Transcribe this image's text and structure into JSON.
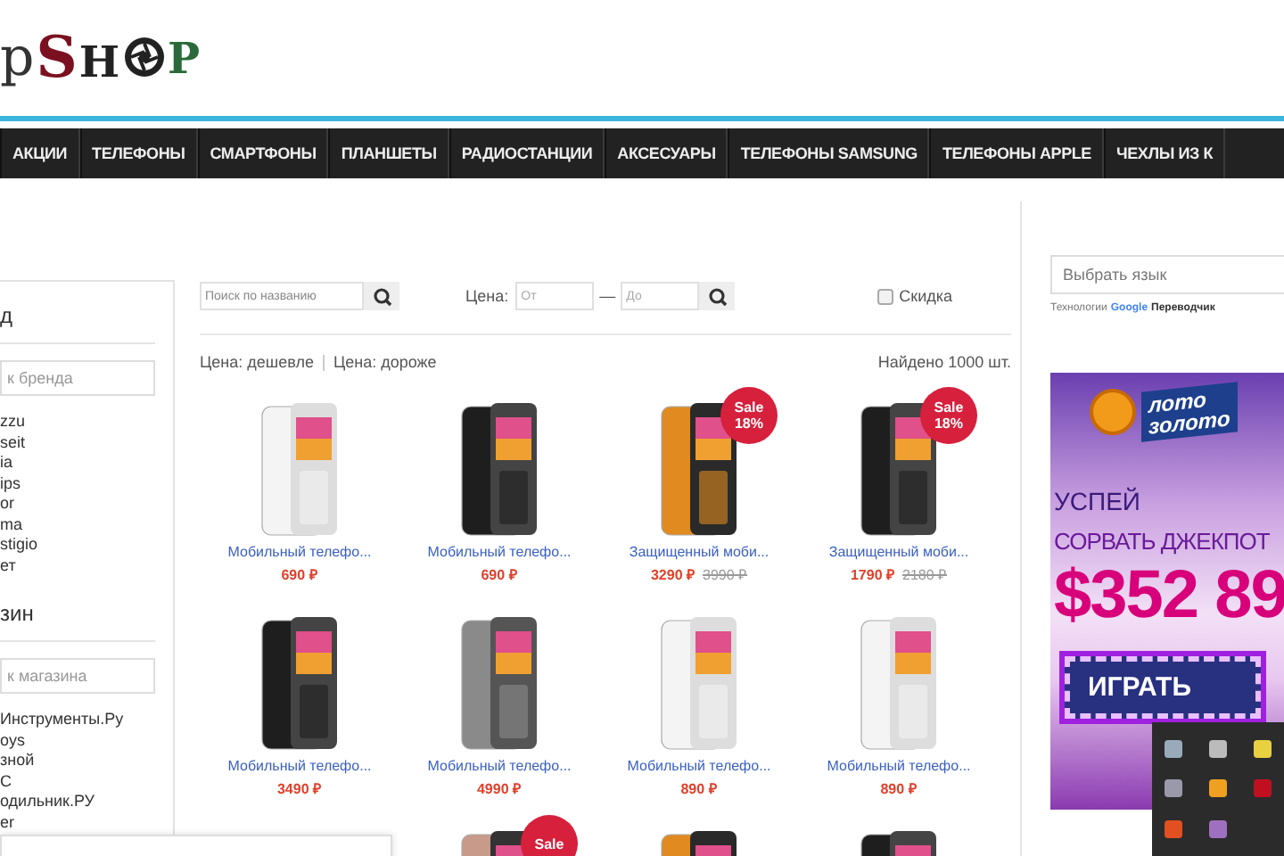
{
  "logo": {
    "prefix": "p",
    "left": "SH",
    "right": "P"
  },
  "nav": [
    "АКЦИИ",
    "ТЕЛЕФОНЫ",
    "СМАРТФОНЫ",
    "ПЛАНШЕТЫ",
    "РАДИОСТАНЦИИ",
    "АКСЕСУАРЫ",
    "ТЕЛЕФОНЫ SAMSUNG",
    "ТЕЛЕФОНЫ APPLE",
    "ЧЕХЛЫ ИЗ К"
  ],
  "sidebar": {
    "brand_heading": "д",
    "brand_search": {
      "placeholder": "к бренда"
    },
    "brands": [
      "zzu",
      "seit",
      "ia",
      "ips",
      "or",
      "ma",
      "stigio",
      "ет"
    ],
    "store_heading": "зин",
    "store_search": {
      "placeholder": "к магазина"
    },
    "stores": [
      "Инструменты.Ру",
      "oys",
      "зной",
      "C",
      "одильник.РУ",
      "er"
    ]
  },
  "filters": {
    "search": {
      "placeholder": "Поиск по названию"
    },
    "price_label": "Цена:",
    "price_from": {
      "placeholder": "От"
    },
    "dash": "—",
    "price_to": {
      "placeholder": "До"
    },
    "discount": {
      "label": "Скидка",
      "checked": false
    }
  },
  "sort": [
    "Цена: дешевле",
    "Цена: дороже"
  ],
  "found": "Найдено 1000 шт.",
  "products": [
    {
      "kind": "light",
      "name": "Мобильный телефо...",
      "price": "690 ₽"
    },
    {
      "kind": "dark",
      "name": "Мобильный телефо...",
      "price": "690 ₽"
    },
    {
      "kind": "rugged",
      "badge": [
        "Sale",
        "18%"
      ],
      "name": "Защищенный моби...",
      "price": "3290 ₽",
      "old_price": "3990 ₽"
    },
    {
      "kind": "dark",
      "badge": [
        "Sale",
        "18%"
      ],
      "name": "Защищенный моби...",
      "price": "1790 ₽",
      "old_price": "2180 ₽"
    },
    {
      "kind": "dark",
      "name": "Мобильный телефо...",
      "price": "3490 ₽"
    },
    {
      "kind": "silver",
      "name": "Мобильный телефо...",
      "price": "4990 ₽"
    },
    {
      "kind": "light",
      "name": "Мобильный телефо...",
      "price": "890 ₽"
    },
    {
      "kind": "light",
      "name": "Мобильный телефо...",
      "price": "890 ₽"
    },
    {
      "kind": "rose",
      "badge": [
        "Sale"
      ]
    },
    {
      "kind": "rugged"
    },
    {
      "kind": "dark"
    }
  ],
  "aside": {
    "language": {
      "placeholder": "Выбрать язык"
    },
    "powered": "Технологии",
    "google": "Google",
    "translate": "Переводчик"
  },
  "banner": {
    "brand": [
      "лото",
      "золото"
    ],
    "line1": "УСПЕЙ",
    "line2": "СОРВАТЬ ДЖЕКПОТ",
    "amount": "$352 89",
    "button": "ИГРАТЬ"
  }
}
